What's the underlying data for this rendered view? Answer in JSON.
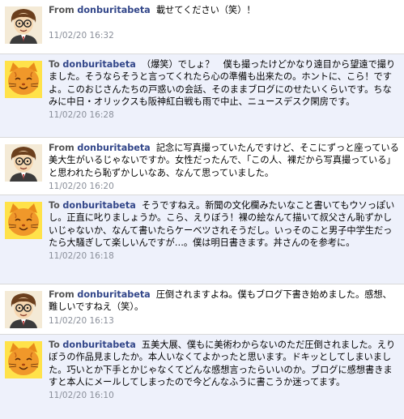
{
  "messages": [
    {
      "direction": "From",
      "user": "donburitabeta",
      "avatar": "man-glasses-avatar",
      "text": "載せてください（笑）！",
      "time": "11/02/20 16:32"
    },
    {
      "direction": "To",
      "user": "donburitabeta",
      "avatar": "orange-cat-avatar",
      "text": "（爆笑）でしょ？　僕も撮ったけどかなり遠目から望遠で撮りました。そうならそうと言ってくれたら心の準備も出来たの。ホントに、こら！ですよ。このおじさんたちの戸惑いの会話、そのままブログにのせたいくらいです。ちなみに中日・オリックスも阪神紅白戦も雨で中止、ニュースデスク閑房です。",
      "time": "11/02/20 16:28"
    },
    {
      "direction": "From",
      "user": "donburitabeta",
      "avatar": "man-glasses-avatar",
      "text": "記念に写真撮っていたんですけど、そこにずっと座っている美大生がいるじゃないですか。女性だったんで、「この人、裸だから写真撮っている」と思われたら恥ずかしいなあ、なんて思っていました。",
      "time": "11/02/20 16:20"
    },
    {
      "direction": "To",
      "user": "donburitabeta",
      "avatar": "orange-cat-avatar",
      "text": "そうですねえ。新聞の文化欄みたいなこと書いてもウソっぽいし。正直に叱りましょうか。こら、えりぼう！裸の絵なんて描いて叔父さん恥ずかしいじゃないか、なんて書いたらケーベツされそうだし。いっそのこと男子中学生だったら大騒ぎして楽しいんですが…。僕は明日書きます。丼さんのを参考に。",
      "time": "11/02/20 16:18"
    },
    {
      "direction": "From",
      "user": "donburitabeta",
      "avatar": "man-glasses-avatar",
      "text": "圧倒されますよね。僕もブログ下書き始めました。感想、難しいですねえ（笑）。",
      "time": "11/02/20 16:13"
    },
    {
      "direction": "To",
      "user": "donburitabeta",
      "avatar": "orange-cat-avatar",
      "text": "五美大展、僕もに美術わからないのただ圧倒されました。えりぼうの作品見ましたか。本人いなくてよかったと思います。ドキッとしてしまいました。巧いとか下手とかじゃなくてどんな感想言ったらいいのか。ブログに感想書きますと本人にメールしてしまったので今どんなふうに書こうか迷ってます。",
      "time": "11/02/20 16:10"
    }
  ]
}
